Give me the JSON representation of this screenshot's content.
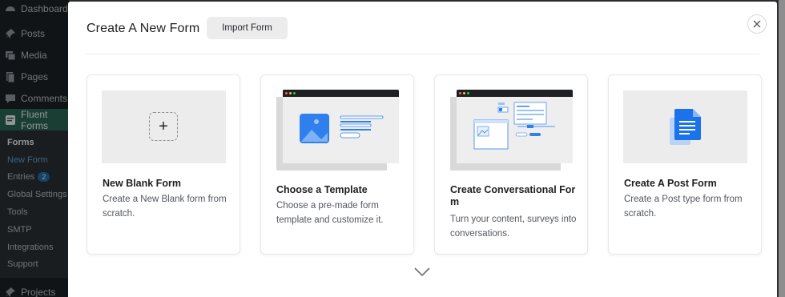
{
  "sidebar": {
    "items_top": [
      {
        "label": "Dashboard",
        "icon": "dashboard-icon"
      },
      {
        "label": "Posts",
        "icon": "pin-icon"
      },
      {
        "label": "Media",
        "icon": "media-icon"
      },
      {
        "label": "Pages",
        "icon": "pages-icon"
      },
      {
        "label": "Comments",
        "icon": "comments-icon"
      },
      {
        "label": "Fluent Forms",
        "icon": "fluent-forms-icon"
      }
    ],
    "submenu": [
      {
        "label": "Forms"
      },
      {
        "label": "New Form"
      },
      {
        "label": "Entries",
        "badge": "2"
      },
      {
        "label": "Global Settings"
      },
      {
        "label": "Tools"
      },
      {
        "label": "SMTP"
      },
      {
        "label": "Integrations"
      },
      {
        "label": "Support"
      }
    ],
    "bottom_item": {
      "label": "Projects",
      "icon": "pin-icon"
    }
  },
  "modal": {
    "title": "Create A New Form",
    "import_label": "Import Form",
    "close_icon": "close-icon",
    "more_icon": "chevron-down-icon",
    "cards": [
      {
        "title": "New Blank Form",
        "description": "Create a New Blank form from scratch."
      },
      {
        "title": "Choose a Template",
        "description": "Choose a pre-made form template and customize it."
      },
      {
        "title": "Create Conversational For m",
        "description": "Turn your content, surveys into conversations."
      },
      {
        "title": "Create A Post Form",
        "description": "Create a Post type form from scratch."
      }
    ]
  },
  "colors": {
    "accent_blue": "#2f80ed",
    "fluent_green": "#2c6b5a",
    "sidebar_bg": "#1d2327"
  }
}
